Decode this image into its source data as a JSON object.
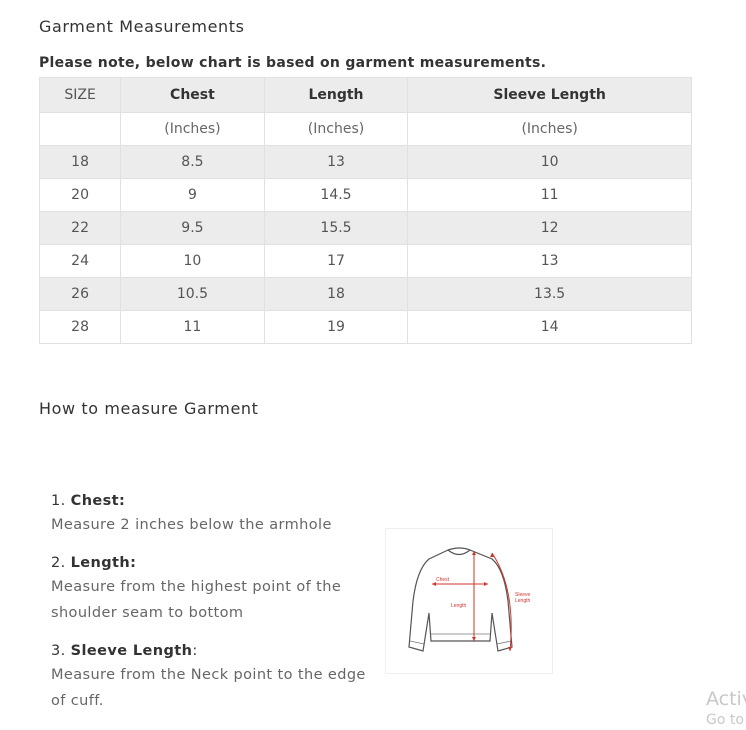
{
  "title": "Garment Measurements",
  "note": "Please note, below chart is based on garment measurements.",
  "table": {
    "headers": [
      "SIZE",
      "Chest",
      "Length",
      "Sleeve Length"
    ],
    "units": [
      "",
      "(Inches)",
      "(Inches)",
      "(Inches)"
    ],
    "rows": [
      [
        "18",
        "8.5",
        "13",
        "10"
      ],
      [
        "20",
        "9",
        "14.5",
        "11"
      ],
      [
        "22",
        "9.5",
        "15.5",
        "12"
      ],
      [
        "24",
        "10",
        "17",
        "13"
      ],
      [
        "26",
        "10.5",
        "18",
        "13.5"
      ],
      [
        "28",
        "11",
        "19",
        "14"
      ]
    ]
  },
  "how_to": {
    "title": "How to measure Garment",
    "steps": [
      {
        "num": "1.",
        "label": "Chest:",
        "suffix": "",
        "desc": "Measure 2 inches below the armhole"
      },
      {
        "num": "2.",
        "label": "Length:",
        "suffix": "",
        "desc": "Measure from the highest point of the shoulder seam to bottom"
      },
      {
        "num": "3.",
        "label": "Sleeve Length",
        "suffix": ":",
        "desc": "Measure from the Neck point to the edge of cuff."
      }
    ]
  },
  "figure": {
    "chest_label": "Chest",
    "length_label": "Length",
    "sleeve_label_1": "Sleeve",
    "sleeve_label_2": "Length",
    "accent": "#d0342c"
  },
  "watermark": {
    "line1": "Activate Windows",
    "line2": "Go to Settings"
  }
}
